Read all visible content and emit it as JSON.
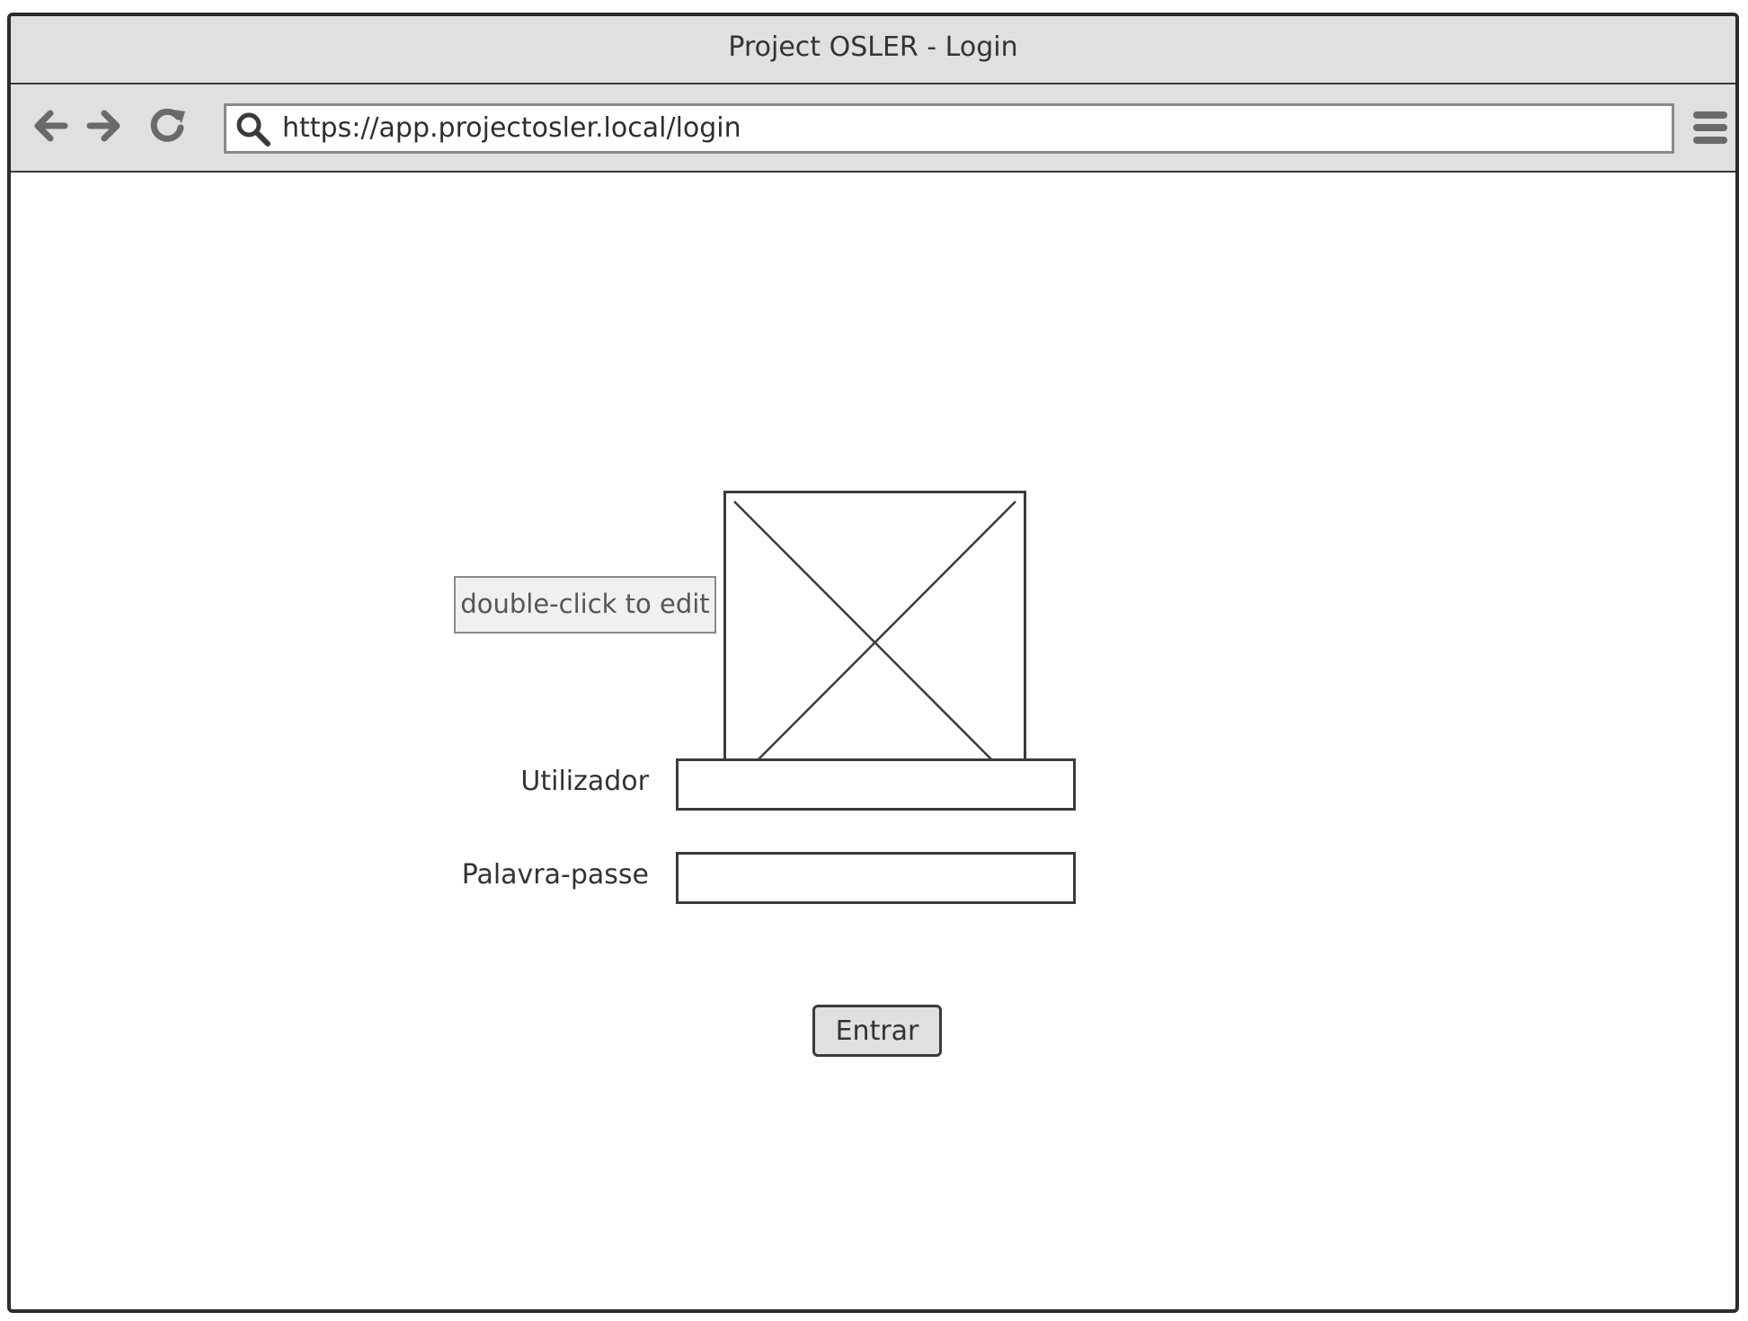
{
  "window": {
    "title": "Project OSLER - Login"
  },
  "toolbar": {
    "back_icon": "arrow-left-icon",
    "forward_icon": "arrow-right-icon",
    "reload_icon": "reload-icon",
    "search_icon": "search-icon",
    "menu_icon": "hamburger-menu-icon",
    "url": "https://app.projectosler.local/login"
  },
  "main": {
    "logo_placeholder_icon": "image-placeholder-icon",
    "edit_hint": "double-click to edit",
    "username_label": "Utilizador",
    "username_value": "",
    "password_label": "Palavra-passe",
    "password_value": "",
    "submit_label": "Entrar"
  },
  "colors": {
    "chrome": "#e0e0e0",
    "border": "#2b2b2b",
    "icon": "#6a6a6a"
  }
}
